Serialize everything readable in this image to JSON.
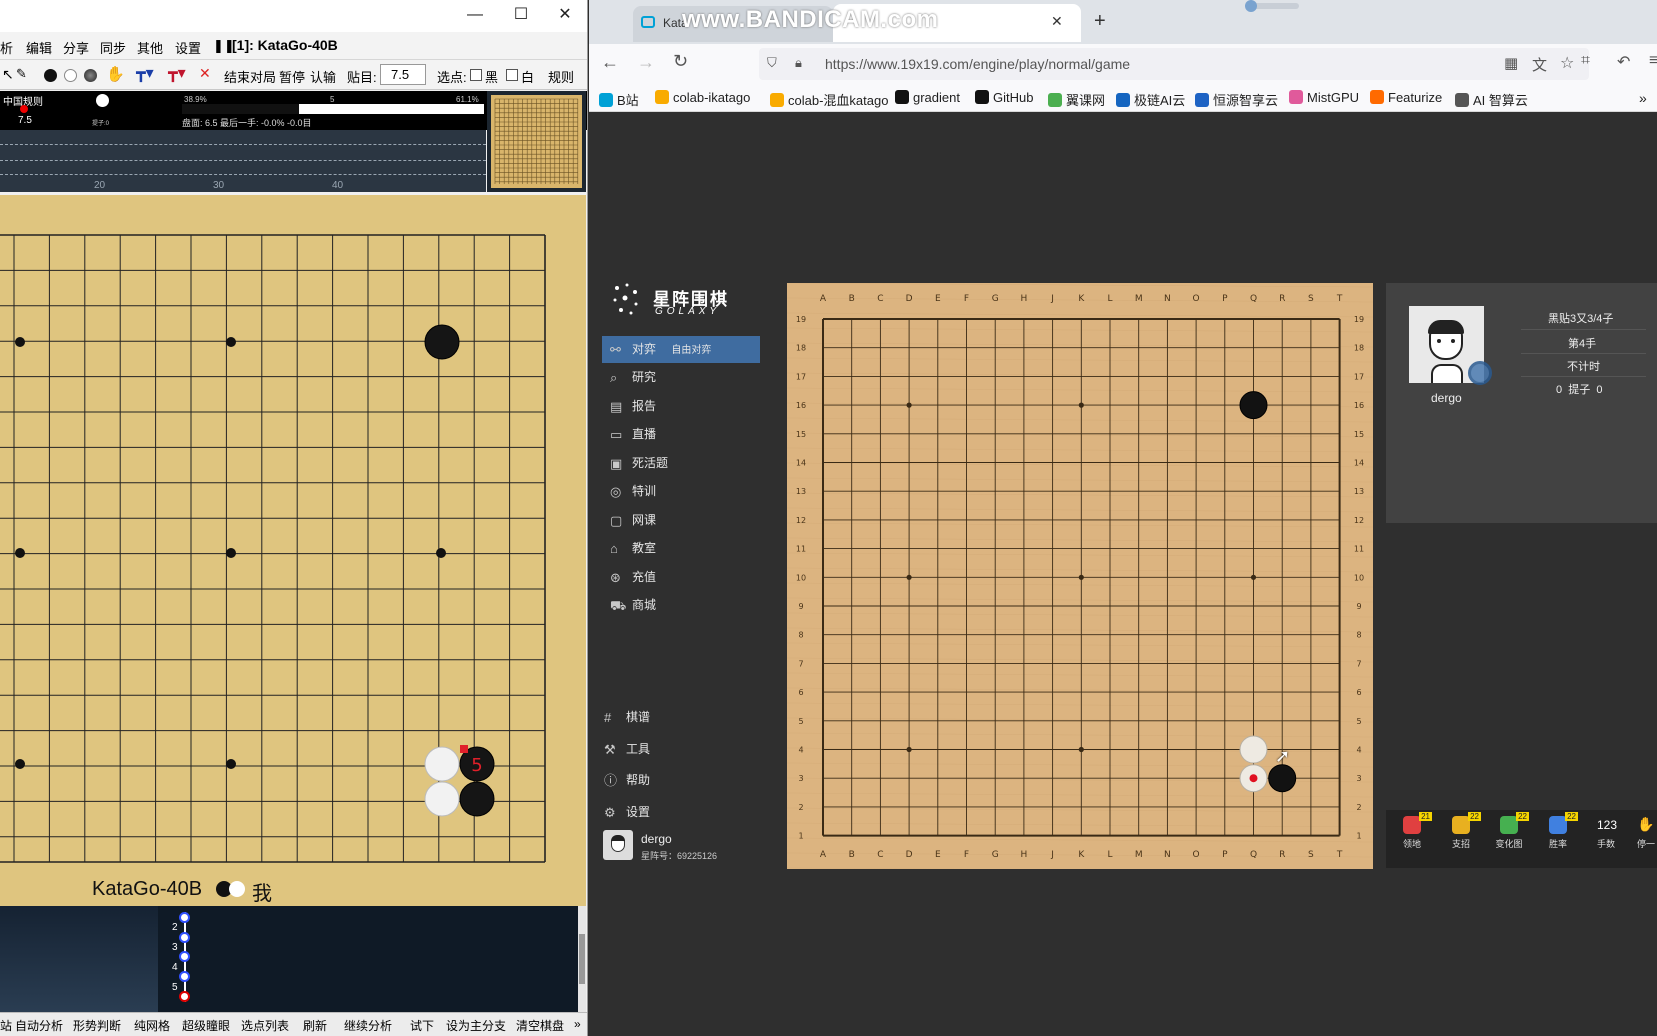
{
  "left_window": {
    "title": "[1]: KataGo-40B",
    "controls": [
      "—",
      "☐",
      "✕"
    ],
    "menu": [
      "析",
      "编辑",
      "分享",
      "同步",
      "其他",
      "设置"
    ],
    "toolbar": {
      "end_game": "结束对局",
      "pause": "暂停",
      "resign": "认输",
      "komi_label": "贴目:",
      "komi_value": "7.5",
      "pick_label": "选点:",
      "black": "黑",
      "white": "白",
      "rules": "规则"
    },
    "stats": {
      "ruleset": "中国规则",
      "komi": "7.5",
      "captures": "提子:0",
      "winrate_left": "38.9%",
      "winrate_mid": "5",
      "winrate_right": "61.1%",
      "info_line": "盘面: 6.5 最后一手: -0.0% -0.0目"
    },
    "graph_ticks": [
      "20",
      "30",
      "40"
    ],
    "player_line": {
      "engine": "KataGo-40B",
      "me": "我"
    },
    "board": {
      "last_move_label": "5"
    },
    "move_list": [
      "2",
      "3",
      "4",
      "5"
    ],
    "statusbar": [
      "站",
      "自动分析",
      "形势判断",
      "纯网格",
      "超级瞳眼",
      "选点列表",
      "刷新",
      "继续分析",
      "试下",
      "设为主分支",
      "清空棋盘",
      "»"
    ]
  },
  "browser": {
    "tabs": [
      {
        "label": "Kata",
        "active": false
      },
      {
        "label": "",
        "active": true
      }
    ],
    "new_tab": "+",
    "watermark": "www.BANDICAM.com",
    "url": "https://www.19x19.com/engine/play/normal/game",
    "bookmarks": [
      {
        "label": "B站",
        "color": "#00a1d6"
      },
      {
        "label": "colab-ikatago",
        "color": "#f9ab00"
      },
      {
        "label": "colab-混血katago",
        "color": "#f9ab00"
      },
      {
        "label": "gradient",
        "color": "#111111"
      },
      {
        "label": "GitHub",
        "color": "#111111"
      },
      {
        "label": "翼课网",
        "color": "#4caf50"
      },
      {
        "label": "极链AI云",
        "color": "#1565c0"
      },
      {
        "label": "恒源智享云",
        "color": "#1e63c4"
      },
      {
        "label": "MistGPU",
        "color": "#e05a9b"
      },
      {
        "label": "Featurize",
        "color": "#ff6a00"
      },
      {
        "label": "AI 智算云",
        "color": "#555555"
      }
    ],
    "overflow": "»"
  },
  "site": {
    "logo_cn": "星阵围棋",
    "logo_en": "GOLAXY",
    "nav": [
      {
        "icon": "play-icon",
        "label": "对弈",
        "sub": "自由对弈",
        "active": true
      },
      {
        "icon": "research-icon",
        "label": "研究"
      },
      {
        "icon": "report-icon",
        "label": "报告"
      },
      {
        "icon": "live-icon",
        "label": "直播"
      },
      {
        "icon": "puzzle-icon",
        "label": "死活题"
      },
      {
        "icon": "target-icon",
        "label": "特训"
      },
      {
        "icon": "class-icon",
        "label": "网课"
      },
      {
        "icon": "home-icon",
        "label": "教室"
      },
      {
        "icon": "recharge-icon",
        "label": "充值"
      },
      {
        "icon": "cart-icon",
        "label": "商城"
      }
    ],
    "nav_bottom": [
      {
        "icon": "grid-icon",
        "label": "棋谱"
      },
      {
        "icon": "tools-icon",
        "label": "工具"
      },
      {
        "icon": "help-icon",
        "label": "帮助"
      },
      {
        "icon": "settings-icon",
        "label": "设置"
      }
    ],
    "user": {
      "name": "dergo",
      "id": "星阵号：69225126"
    },
    "board": {
      "columns": [
        "A",
        "B",
        "C",
        "D",
        "E",
        "F",
        "G",
        "H",
        "J",
        "K",
        "L",
        "M",
        "N",
        "O",
        "P",
        "Q",
        "R",
        "S",
        "T"
      ],
      "rows": [
        "19",
        "18",
        "17",
        "16",
        "15",
        "14",
        "13",
        "12",
        "11",
        "10",
        "9",
        "8",
        "7",
        "6",
        "5",
        "4",
        "3",
        "2",
        "1"
      ]
    },
    "player_panel": {
      "name": "dergo",
      "komi": "黑贴3又3/4子",
      "move_no": "第4手",
      "timer": "不计时",
      "captures": "0  提子  0"
    },
    "tools": [
      {
        "label": "领地",
        "badge": "21",
        "color": "#e04040"
      },
      {
        "label": "支招",
        "badge": "22",
        "color": "#e8b020"
      },
      {
        "label": "变化图",
        "badge": "22",
        "color": "#46b050"
      },
      {
        "label": "胜率",
        "badge": "22",
        "color": "#4080e0"
      },
      {
        "label": "手数",
        "badge": "",
        "text": "123",
        "color": "transparent"
      },
      {
        "label": "停一",
        "badge": "",
        "color": "transparent"
      }
    ]
  }
}
